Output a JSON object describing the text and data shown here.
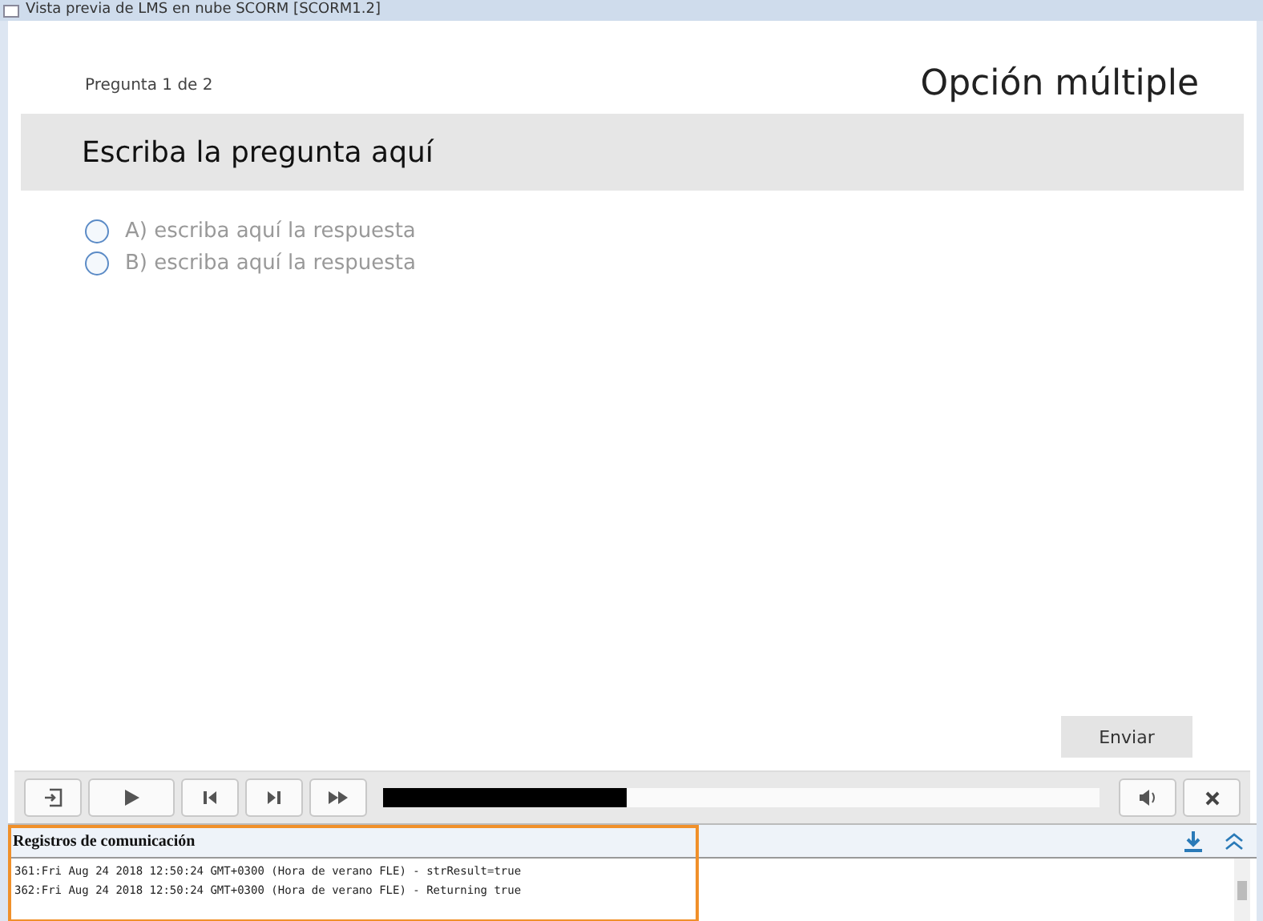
{
  "window": {
    "title": "Vista previa de LMS en nube SCORM [SCORM1.2]"
  },
  "question": {
    "counter": "Pregunta 1 de 2",
    "type_title": "Opción múltiple",
    "prompt": "Escriba la pregunta aquí",
    "options": [
      {
        "label": "A) escriba aquí la respuesta",
        "selected": false
      },
      {
        "label": "B) escriba aquí la respuesta",
        "selected": false
      }
    ],
    "submit": "Enviar"
  },
  "player": {
    "progress": {
      "level": 0.34
    }
  },
  "log": {
    "title": "Registros de comunicación",
    "lines": [
      "361:Fri Aug 24 2018 12:50:24 GMT+0300 (Hora de verano FLE) - strResult=true",
      "362:Fri Aug 24 2018 12:50:24 GMT+0300 (Hora de verano FLE) - Returning true"
    ]
  }
}
